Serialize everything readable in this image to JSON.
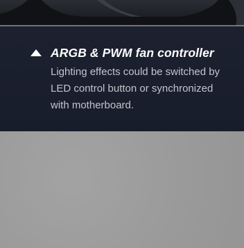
{
  "feature": {
    "bullet_icon": "triangle-up-icon",
    "title": "ARGB & PWM fan controller",
    "description": "Lighting effects could be switched by\nLED control button or synchronized\nwith motherboard."
  },
  "colors": {
    "panel_background": "#1c2130",
    "title_text": "#ffffff",
    "description_text": "#c2c5cc",
    "lower_background": "#9c9c9c"
  }
}
